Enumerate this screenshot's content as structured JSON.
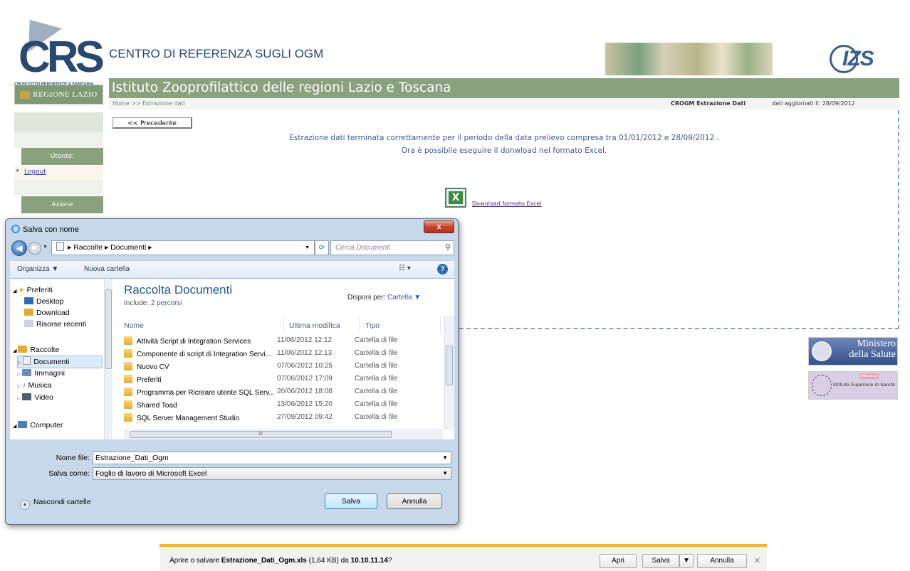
{
  "header": {
    "crs_logo_letters": "CRS",
    "crs_logo_subtitle": "CRUSCOTTO REPORTISTICA SANITARIA",
    "site_title": "CENTRO DI REFERENZA SUGLI OGM",
    "izs_logo_text": "IZS",
    "region_label": "REGIONE LAZIO",
    "institute_name": "Istituto Zooprofilattico delle regioni Lazio e Toscana",
    "breadcrumb": "Home >> Estrazione dati",
    "section_name": "CROGM Estrazione Dati",
    "updated_text": "dati aggiornati il: 28/09/2012"
  },
  "sidebar": {
    "user_label": "Utente:",
    "logout_bullet": "•",
    "logout_label": "Logout",
    "action_label": "Azione"
  },
  "content": {
    "prev_button": "<< Precedente",
    "message_line1": "Estrazione dati terminata correttamente per il periodo della data prelievo compresa tra 01/01/2012 e 28/09/2012 .",
    "message_line2": "Ora è possibile eseguire il donwload nel formato Excel.",
    "download_link": "Download formato Excel",
    "xls_icon_letter": "X"
  },
  "logos": {
    "ministero_line1": "Ministero",
    "ministero_line2": "della Salute",
    "iss_top": "Web.iss.it",
    "iss_text": "Istituto Superiore di Sanità"
  },
  "dialog": {
    "title": "Salva con nome",
    "close_glyph": "x",
    "path": [
      "Raccolte",
      "Documenti"
    ],
    "search_placeholder": "Cerca Documenti",
    "organize": "Organizza ▼",
    "new_folder": "Nuova cartella",
    "nav": {
      "favorites_header": "Preferiti",
      "favorites": [
        "Desktop",
        "Download",
        "Risorse recenti"
      ],
      "libraries_header": "Raccolte",
      "libraries": [
        "Documenti",
        "Immagini",
        "Musica",
        "Video"
      ],
      "computer": "Computer"
    },
    "library_title": "Raccolta Documenti",
    "include_label": "Include:",
    "include_value": "2 percorsi",
    "arrange_label": "Disponi per:",
    "arrange_value": "Cartella ▼",
    "columns": {
      "name": "Nome",
      "modified": "Ultima modifica",
      "type": "Tipo"
    },
    "files": [
      {
        "name": "Attività Script di Integration Services",
        "date": "11/06/2012 12:12",
        "type": "Cartella di file"
      },
      {
        "name": "Componente di script di Integration Servi...",
        "date": "11/06/2012 12:13",
        "type": "Cartella di file"
      },
      {
        "name": "Nuovo CV",
        "date": "07/06/2012 10:25",
        "type": "Cartella di file"
      },
      {
        "name": "Preferiti",
        "date": "07/06/2012 17:09",
        "type": "Cartella di file"
      },
      {
        "name": "Programma per Ricreare utente SQL Serv...",
        "date": "20/06/2012 18:08",
        "type": "Cartella di file"
      },
      {
        "name": "Shared Toad",
        "date": "13/06/2012 15:20",
        "type": "Cartella di file"
      },
      {
        "name": "SQL Server Management Studio",
        "date": "27/09/2012 09:42",
        "type": "Cartella di file"
      }
    ],
    "filename_label": "Nome file:",
    "filename_value": "Estrazione_Dati_Ogm",
    "savetype_label": "Salva come:",
    "savetype_value": "Foglio di lavoro di Microsoft Excel",
    "hide_folders": "Nascondi cartelle",
    "save_button": "Salva",
    "cancel_button": "Annulla"
  },
  "download_bar": {
    "prefix": "Aprire o salvare ",
    "filename": "Estrazione_Dati_Ogm.xls",
    "size": " (1,64 KB) da ",
    "host": "10.10.11.14",
    "suffix": "?",
    "open_button": "Apri",
    "save_button": "Salva",
    "cancel_button": "Annulla"
  }
}
